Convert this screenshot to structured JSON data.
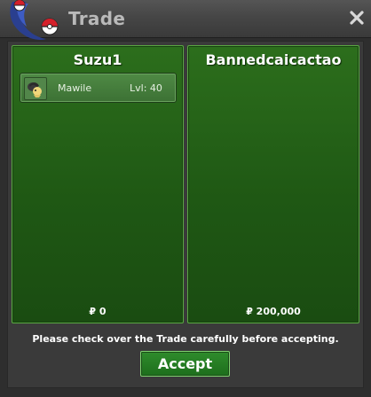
{
  "window": {
    "title": "Trade"
  },
  "icons": {
    "logo": "pokeball-logo-icon",
    "close": "close-icon",
    "item": "mawile-sprite-icon"
  },
  "left_panel": {
    "player": "Suzu1",
    "items": [
      {
        "name": "Mawile",
        "level": "Lvl: 40"
      }
    ],
    "money": "₽ 0"
  },
  "right_panel": {
    "player": "Bannedcaicactao",
    "items": [],
    "money": "₽ 200,000"
  },
  "notice": "Please check over the Trade carefully before accepting.",
  "accept_label": "Accept",
  "colors": {
    "panel_green": "#1f5814",
    "panel_border": "#5aa843",
    "accept_green": "#1d6e1c"
  }
}
